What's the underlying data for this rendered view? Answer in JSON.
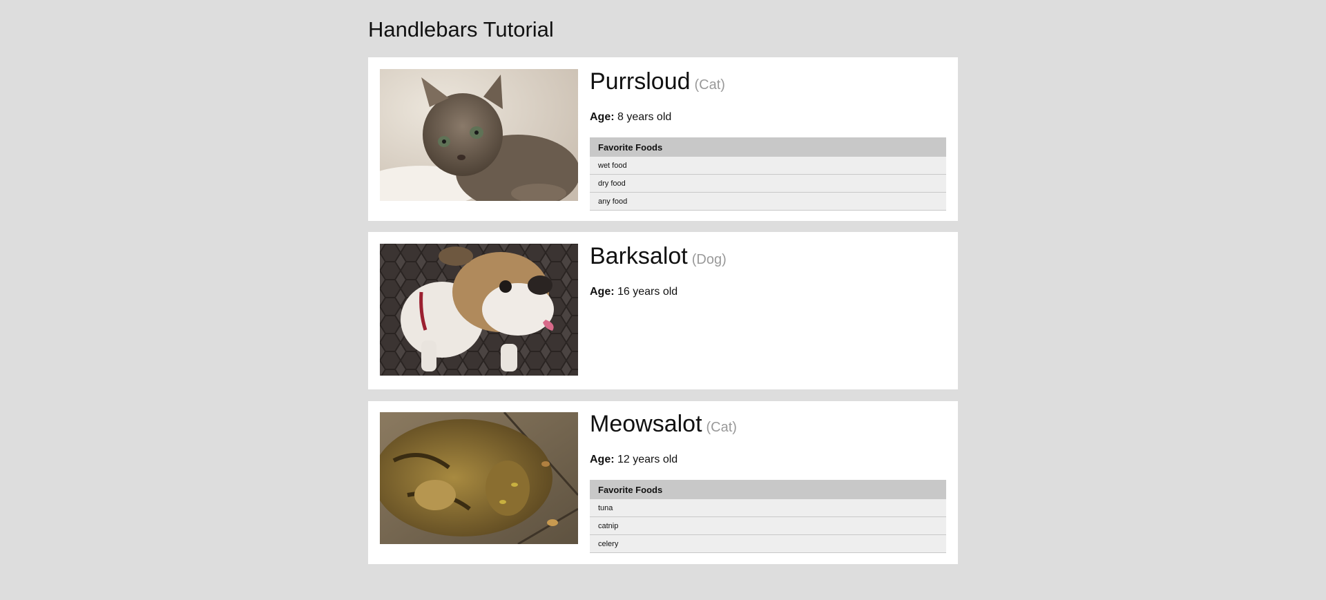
{
  "page": {
    "title": "Handlebars Tutorial"
  },
  "age_label": "Age:",
  "pets": [
    {
      "name": "Purrsloud",
      "species": "(Cat)",
      "age": "8 years old",
      "photo_icon": "kitten-photo",
      "foods_header": "Favorite Foods",
      "foods": [
        "wet food",
        "dry food",
        "any food"
      ]
    },
    {
      "name": "Barksalot",
      "species": "(Dog)",
      "age": "16 years old",
      "photo_icon": "bulldog-photo"
    },
    {
      "name": "Meowsalot",
      "species": "(Cat)",
      "age": "12 years old",
      "photo_icon": "tabby-cat-photo",
      "foods_header": "Favorite Foods",
      "foods": [
        "tuna",
        "catnip",
        "celery"
      ]
    }
  ],
  "colors": {
    "page_background": "#dddddd",
    "card_background": "#ffffff",
    "species_text": "#999999",
    "table_header": "#c8c8c8",
    "table_row": "#eeeeee"
  }
}
